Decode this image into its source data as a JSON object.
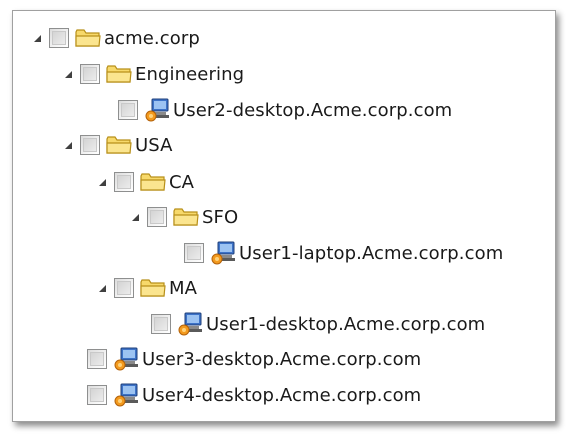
{
  "tree": {
    "nodes": [
      {
        "label": "acme.corp",
        "type": "folder",
        "expanded": true
      },
      {
        "label": "Engineering",
        "type": "folder",
        "expanded": true
      },
      {
        "label": "User2-desktop.Acme.corp.com",
        "type": "computer"
      },
      {
        "label": "USA",
        "type": "folder",
        "expanded": true
      },
      {
        "label": "CA",
        "type": "folder",
        "expanded": true
      },
      {
        "label": "SFO",
        "type": "folder",
        "expanded": true
      },
      {
        "label": "User1-laptop.Acme.corp.com",
        "type": "computer"
      },
      {
        "label": "MA",
        "type": "folder",
        "expanded": true
      },
      {
        "label": "User1-desktop.Acme.corp.com",
        "type": "computer"
      },
      {
        "label": "User3-desktop.Acme.corp.com",
        "type": "computer"
      },
      {
        "label": "User4-desktop.Acme.corp.com",
        "type": "computer"
      }
    ]
  },
  "icons": {
    "folder": "folder-icon",
    "computer": "computer-icon",
    "expander": "expanded-triangle-icon"
  },
  "colors": {
    "folder_fill": "#f7d96b",
    "folder_stroke": "#b8901a",
    "monitor_blue": "#3d73c8",
    "badge_orange": "#f39a1e"
  }
}
